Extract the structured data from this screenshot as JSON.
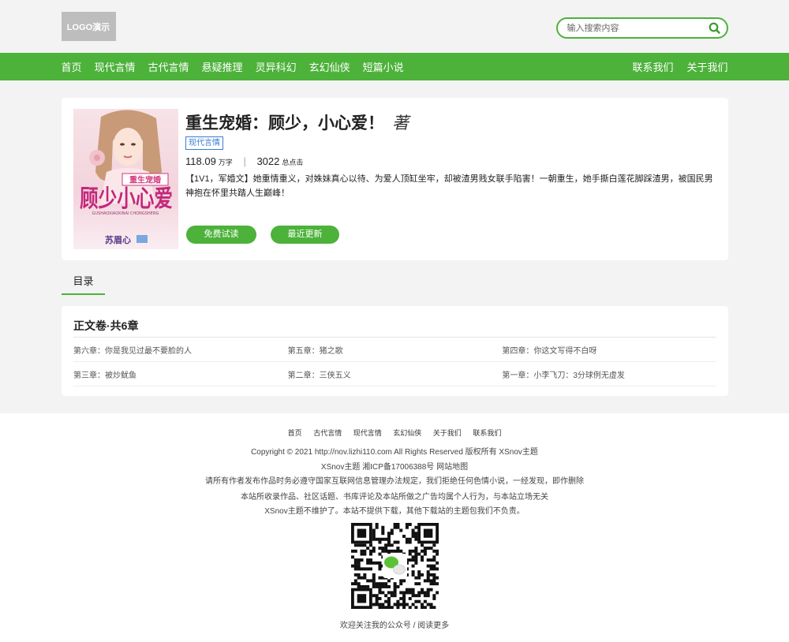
{
  "header": {
    "logo_text": "LOGO演示",
    "search_placeholder": "输入搜索内容"
  },
  "nav": {
    "left": [
      "首页",
      "现代言情",
      "古代言情",
      "悬疑推理",
      "灵异科幻",
      "玄幻仙侠",
      "短篇小说"
    ],
    "right": [
      "联系我们",
      "关于我们"
    ]
  },
  "book": {
    "title": "重生宠婚：顾少，小心爱！",
    "author_suffix": "著",
    "tag": "现代言情",
    "word_count": "118.09",
    "word_unit": "万字",
    "clicks": "3022",
    "click_unit": "总点击",
    "intro": "【1V1，军婚文】她重情重义，对姝妹真心以待、为爱人顶缸坐牢，却被渣男贱女联手陷害！一朝重生，她手撕白莲花脚踩渣男，被国民男神抱在怀里共踏人生巅峰！",
    "read_button": "免费试读",
    "latest_button": "最近更新",
    "cover": {
      "title_main": "顾少小心爱",
      "title_tag": "重生宠婚",
      "pinyin": "GUSHAOXIAOXINAI CHONGSHENG",
      "cover_author": "苏眉心"
    }
  },
  "toc_tab": "目录",
  "volume": {
    "title": "正文卷·共6章",
    "chapters": [
      [
        "第六章：你是我见过最不要脸的人",
        "第五章：猪之歌",
        "第四章：你这文写得不白呀"
      ],
      [
        "第三章：被炒鱿鱼",
        "第二章：三侠五义",
        "第一章：小李飞刀：3分球例无虚发"
      ]
    ]
  },
  "footer": {
    "links": [
      "首页",
      "古代言情",
      "现代言情",
      "玄幻仙侠",
      "关于我们",
      "联系我们"
    ],
    "copyright": "Copyright © 2021 http://nov.lizhi110.com All Rights Reserved 版权所有 XSnov主题",
    "icp": "XSnov主题 湘ICP备17006388号 网站地图",
    "notice1": "请所有作者发布作品时务必遵守国家互联网信息管理办法规定，我们拒绝任何色情小说，一经发现，即作删除",
    "notice2": "本站所收录作品、社区话题、书库评论及本站所做之广告均属个人行为，与本站立场无关",
    "notice3": "XSnov主题不维护了。本站不提供下载，其他下载站的主题包我们不负责。",
    "qr_caption": "欢迎关注我的公众号 / 阅读更多"
  },
  "colors": {
    "accent": "#4cb23a",
    "tag_blue": "#3a7bd5"
  }
}
